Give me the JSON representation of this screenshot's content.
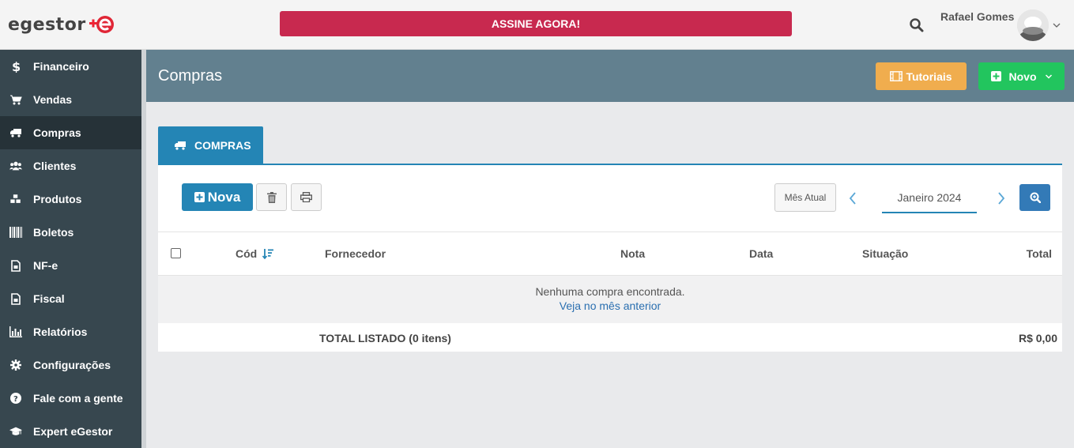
{
  "brand": {
    "logo_text": "egestor",
    "colors": {
      "accent": "#2485b5",
      "subscribe": "#c8294f",
      "tutorials": "#f0ad4e",
      "novo": "#22c55e",
      "sidebar": "#37474f"
    }
  },
  "topbar": {
    "subscribe_label": "ASSINE AGORA!",
    "user_name": "Rafael Gomes"
  },
  "sidebar": {
    "items": [
      {
        "label": "Financeiro",
        "icon": "dollar-icon"
      },
      {
        "label": "Vendas",
        "icon": "cart-icon"
      },
      {
        "label": "Compras",
        "icon": "truck-icon",
        "active": true
      },
      {
        "label": "Clientes",
        "icon": "users-icon"
      },
      {
        "label": "Produtos",
        "icon": "cubes-icon"
      },
      {
        "label": "Boletos",
        "icon": "barcode-icon"
      },
      {
        "label": "NF-e",
        "icon": "document-icon"
      },
      {
        "label": "Fiscal",
        "icon": "document-icon"
      },
      {
        "label": "Relatórios",
        "icon": "bar-chart-icon"
      },
      {
        "label": "Configurações",
        "icon": "gear-icon"
      },
      {
        "label": "Fale com a gente",
        "icon": "question-icon"
      },
      {
        "label": "Expert eGestor",
        "icon": "graduation-cap-icon"
      }
    ]
  },
  "header": {
    "title": "Compras",
    "tutorials_label": "Tutoriais",
    "new_label": "Novo"
  },
  "tab": {
    "label": "COMPRAS"
  },
  "toolbar": {
    "new_label": "Nova",
    "current_month_label": "Mês Atual",
    "month": "Janeiro 2024"
  },
  "table": {
    "columns": [
      "Cód",
      "Fornecedor",
      "Nota",
      "Data",
      "Situação",
      "Total"
    ],
    "empty_message": "Nenhuma compra encontrada.",
    "empty_link": "Veja no mês anterior",
    "total_label": "TOTAL LISTADO (0 itens)",
    "total_value": "R$ 0,00"
  }
}
